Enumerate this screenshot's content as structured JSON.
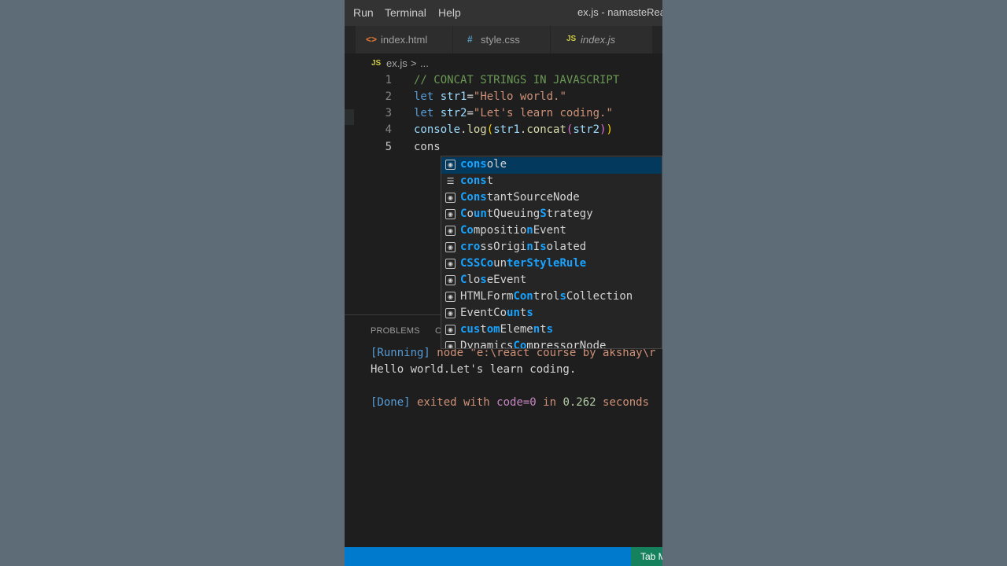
{
  "menu": {
    "run": "Run",
    "terminal": "Terminal",
    "help": "Help",
    "window_title": "ex.js - namasteReac"
  },
  "tabs": [
    {
      "icon": "<>",
      "label": "index.html"
    },
    {
      "icon": "#",
      "label": "style.css"
    },
    {
      "icon": "JS",
      "label": "index.js"
    }
  ],
  "breadcrumb": {
    "icon": "JS",
    "file": "ex.js",
    "sep": ">",
    "rest": "..."
  },
  "editor": {
    "line_numbers": [
      "1",
      "2",
      "3",
      "4",
      "5"
    ],
    "line1_comment": "// CONCAT STRINGS IN JAVASCRIPT",
    "line2_kw": "let",
    "line2_var": "str1",
    "line2_eq": "=",
    "line2_str": "\"Hello world.\"",
    "line3_kw": "let",
    "line3_var": "str2",
    "line3_eq": "=",
    "line3_str": "\"Let's learn coding.\"",
    "line4_obj": "console",
    "line4_dot": ".",
    "line4_fn": "log",
    "line4_p1": "(",
    "line4_arg": "str1",
    "line4_dot2": ".",
    "line4_fn2": "concat",
    "line4_p2": "(",
    "line4_arg2": "str2",
    "line4_p3": ")",
    "line4_p4": ")",
    "line5_typed": "cons"
  },
  "suggestions": [
    {
      "icon": "variable-icon",
      "parts": [
        "cons",
        "ole"
      ],
      "hl": [
        0
      ]
    },
    {
      "icon": "keyword-icon",
      "parts": [
        "cons",
        "t"
      ],
      "hl": [
        0
      ]
    },
    {
      "icon": "variable-icon",
      "parts": [
        "Cons",
        "tantSourceNode"
      ],
      "hl": [
        0
      ]
    },
    {
      "icon": "variable-icon",
      "parts": [
        "C",
        "o",
        "u",
        "n",
        "tQueuing",
        "S",
        "trategy"
      ],
      "hl": [
        0,
        2,
        3,
        5
      ]
    },
    {
      "icon": "variable-icon",
      "parts": [
        "Co",
        "mpositio",
        "n",
        "Event"
      ],
      "hl": [
        0,
        2
      ]
    },
    {
      "icon": "variable-icon",
      "parts": [
        "cr",
        "o",
        "ssOrigi",
        "n",
        "I",
        "s",
        "olated"
      ],
      "hl": [
        0,
        1,
        3,
        5
      ]
    },
    {
      "icon": "variable-icon",
      "parts": [
        "CSSCo",
        "u",
        "n",
        "terStyleRule"
      ],
      "hl": [
        0,
        3
      ]
    },
    {
      "icon": "variable-icon",
      "parts": [
        "C",
        "lo",
        "s",
        "eEve",
        "n",
        "t"
      ],
      "hl": [
        0,
        2
      ]
    },
    {
      "icon": "variable-icon",
      "parts": [
        "HTMLForm",
        "Con",
        "trol",
        "s",
        "Collection"
      ],
      "hl": [
        1,
        3
      ]
    },
    {
      "icon": "variable-icon",
      "parts": [
        "EventCo",
        "u",
        "n",
        "t",
        "s"
      ],
      "hl": [
        1,
        2,
        4
      ]
    },
    {
      "icon": "variable-icon",
      "parts": [
        "cus",
        "t",
        "om",
        "Eleme",
        "n",
        "t",
        "s"
      ],
      "hl": [
        0,
        2,
        4,
        6
      ]
    },
    {
      "icon": "variable-icon",
      "parts": [
        "Dynamics",
        "Co",
        "mpressorNode"
      ],
      "hl": [
        1
      ]
    }
  ],
  "panel": {
    "problems_tab": "PROBLEMS",
    "output_tab_partial": "C",
    "out1_a": "[Running]",
    "out1_b": " node \"e:\\react course by akshay\\r",
    "out2": "Hello world.Let's learn coding.",
    "out3_a": "[Done]",
    "out3_b": " exited with ",
    "out3_c": "code=0",
    "out3_d": " in ",
    "out3_e": "0.262",
    "out3_f": " seconds"
  },
  "status": {
    "right_label": "Tab M"
  }
}
